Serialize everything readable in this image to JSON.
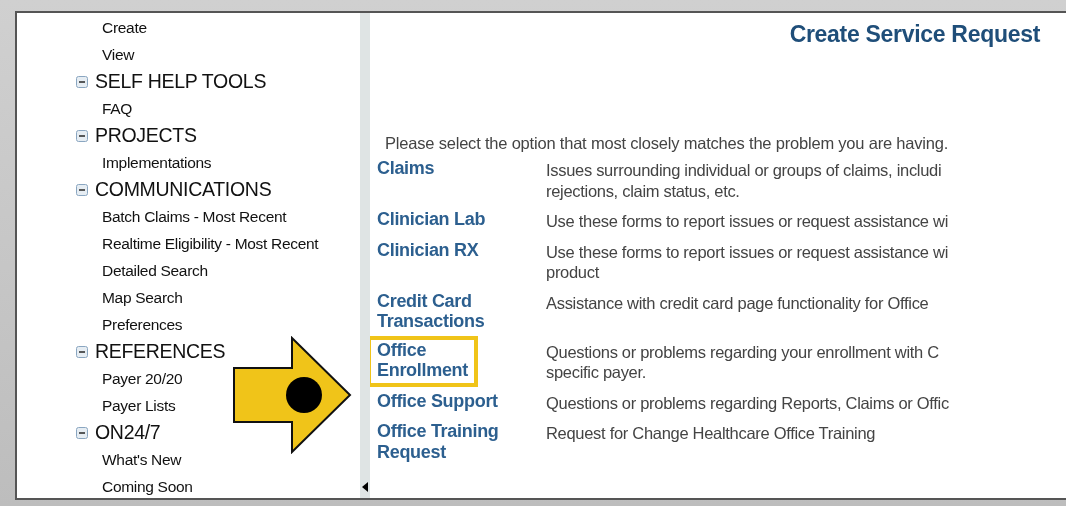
{
  "sidebar": {
    "items": [
      {
        "label": "Create",
        "kind": "item"
      },
      {
        "label": "View",
        "kind": "item"
      },
      {
        "label": "SELF HELP TOOLS",
        "kind": "header",
        "expanded": true
      },
      {
        "label": "FAQ",
        "kind": "item"
      },
      {
        "label": "PROJECTS",
        "kind": "header",
        "expanded": true
      },
      {
        "label": "Implementations",
        "kind": "item"
      },
      {
        "label": "COMMUNICATIONS",
        "kind": "header",
        "expanded": true
      },
      {
        "label": "Batch Claims - Most Recent",
        "kind": "item"
      },
      {
        "label": "Realtime Eligibility - Most Recent",
        "kind": "item"
      },
      {
        "label": "Detailed Search",
        "kind": "item"
      },
      {
        "label": "Map Search",
        "kind": "item"
      },
      {
        "label": "Preferences",
        "kind": "item"
      },
      {
        "label": "REFERENCES",
        "kind": "header",
        "expanded": true
      },
      {
        "label": "Payer 20/20",
        "kind": "item"
      },
      {
        "label": "Payer Lists",
        "kind": "item"
      },
      {
        "label": "ON24/7",
        "kind": "header",
        "expanded": true
      },
      {
        "label": "What's New",
        "kind": "item"
      },
      {
        "label": "Coming Soon",
        "kind": "item"
      }
    ]
  },
  "main": {
    "title": "Create Service Request",
    "instruction": "Please select the option that most closely matches the problem you are having.",
    "options": [
      {
        "link": "Claims",
        "description": "Issues surrounding individual or groups of claims, includi\nrejections, claim status, etc.",
        "highlighted": false
      },
      {
        "link": "Clinician Lab",
        "description": "Use these forms to report issues or request assistance wi",
        "highlighted": false
      },
      {
        "link": "Clinician RX",
        "description": "Use these forms to report issues or request assistance wi\nproduct",
        "highlighted": false
      },
      {
        "link": "Credit Card\nTransactions",
        "description": "Assistance with credit card page functionality for Office",
        "highlighted": false
      },
      {
        "link": "Office\nEnrollment",
        "description": "Questions or problems regarding your enrollment with C\nspecific payer.",
        "highlighted": true
      },
      {
        "link": "Office Support",
        "description": "Questions or problems regarding Reports, Claims or Offic",
        "highlighted": false
      },
      {
        "link": "Office Training\nRequest",
        "description": "Request for Change Healthcare Office Training",
        "highlighted": false
      }
    ]
  }
}
